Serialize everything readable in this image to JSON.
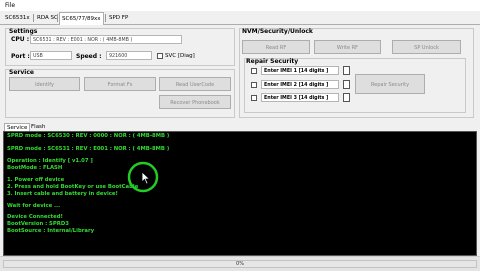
{
  "menu": {
    "file": "File"
  },
  "tabs": [
    "SC6531x",
    "RDA SC",
    "SC65/77/89xx",
    "SPD FP"
  ],
  "active_tab_index": 2,
  "settings": {
    "title": "Settings",
    "cpu_label": "CPU :",
    "cpu_value": "SC6531 : REV : E001 : NOR : ( 4MB-8MB )",
    "port_label": "Port :",
    "port_value": "USB",
    "speed_label": "Speed :",
    "speed_value": "921600",
    "svc_label": "SVC [Diag]"
  },
  "service": {
    "title": "Service",
    "identify": "Identify",
    "format_fs": "Format Fs",
    "read_usercode": "Read UserCode",
    "recover_phonebook": "Recover Phonebook"
  },
  "nvm": {
    "title": "NVM/Security/Unlock",
    "read_rf": "Read RF",
    "write_rf": "Write RF",
    "sp_unlock": "SP Unlock",
    "repair_title": "Repair Security",
    "imei1": "Enter IMEI 1 [14 digits ]",
    "imei2": "Enter IMEI 2 [14 digits ]",
    "imei3": "Enter IMEI 3 [14 digits ]",
    "repair_button": "Repair Security"
  },
  "bottom_tabs": [
    "Service",
    "Flash"
  ],
  "console_lines": [
    "SPRD mode : SC6530 : REV : 0000 : NOR : ( 4MB-8MB )",
    "SPRD mode : SC6531 : REV : E001 : NOR : ( 4MB-8MB )",
    "Operation : Identify [ v1.07 ]",
    "BootMode : FLASH",
    "1. Power off device",
    "2. Press and hold BootKey or use BootCable",
    "3. Insert cable and battery in device!",
    "Wait for device ...",
    "Device Connected!",
    "BootVersion : SPRD3",
    "BootSource : Internal/Library"
  ],
  "status": {
    "progress_text": "0%",
    "progress_value": 0
  },
  "colors": {
    "console_bg": "#000000",
    "console_text": "#33dd33",
    "cursor_ring": "#22cc22"
  }
}
